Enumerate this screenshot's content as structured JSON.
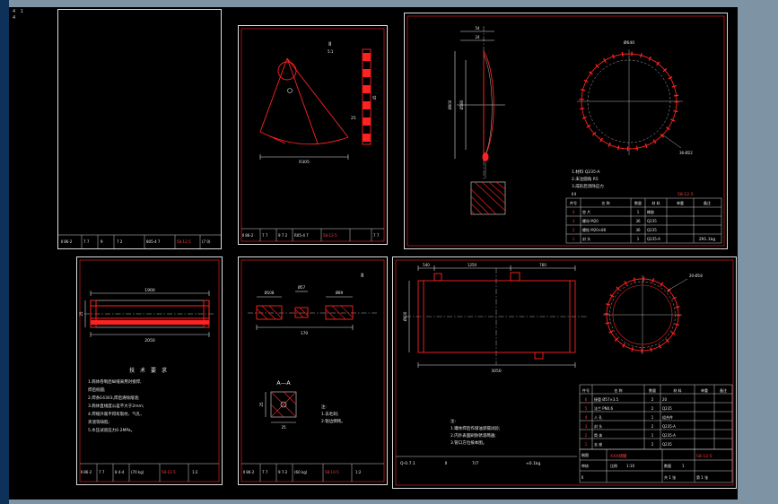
{
  "colors": {
    "frame": "#7e93a4",
    "sidebar": "#0d3158",
    "canvas": "#000000",
    "line_red": "#ff2222",
    "line_white": "#e8e8e8"
  },
  "corner_note": {
    "l1": "4 1",
    "l2": "4"
  },
  "p1": {
    "footer": [
      "Ⅱ 86-2",
      "7 7",
      "9",
      "7 2",
      "805-4 7",
      "58-12-5",
      "(7 0)"
    ]
  },
  "p2": {
    "mark": "Ⅱ",
    "scale": "5:1",
    "dim_r": "R305",
    "dim_a": "25",
    "dim_b": "45",
    "footer": [
      "Ⅱ 86-2",
      "7 7",
      "9 7 2",
      "R05-4 7",
      "58-12-5",
      "7 7"
    ]
  },
  "p3": {
    "dim_t1": "54",
    "dim_t2": "24",
    "dim_l1": "Ø600",
    "dim_l2": "Ø580",
    "dim_c": "Ø640",
    "leader": "36-Ø22",
    "notes": [
      "1.材料 Q235-A",
      "2.未注圆角 R5",
      "3.成形后消除应力"
    ],
    "tag": "Ⅱ Ⅱ",
    "code": "58-12-5",
    "hdr": [
      "件号",
      "名 称",
      "数量",
      "材 料",
      "单重",
      "备注"
    ],
    "rows": [
      [
        "4",
        "垫 片",
        "1",
        "橡胶"
      ],
      [
        "3",
        "螺母 M20",
        "36",
        "Q235"
      ],
      [
        "2",
        "螺栓 M20×80",
        "36",
        "Q235"
      ],
      [
        "1",
        "封 头",
        "1",
        "Q235-A"
      ]
    ],
    "mass": "291.1kg"
  },
  "p4": {
    "dim_top": "1900",
    "dim_bot": "2050",
    "dim_left": "25",
    "tech_title": "技 术 要 求",
    "notes": [
      "1.筒体卷制后纵缝采用对接焊,",
      "  焊后校圆;",
      "2.焊条E4303,焊后清除熔渣;",
      "3.筒体直线度公差不大于2mm;",
      "4.焊缝外观不得有裂纹、气孔、",
      "  夹渣等缺陷;",
      "5.水压试验压力0.2MPa。"
    ],
    "footer": [
      "Ⅱ 86-2",
      "7 7",
      "8 4-4",
      "(70 kg)",
      "58-12-5",
      "1:2"
    ]
  },
  "p5": {
    "mark": "Ⅱ",
    "dim_1": "Ø108",
    "dim_2": "Ø57",
    "dim_3": "Ø89",
    "dim_bot": "170",
    "section": "A—A",
    "sq_v": "25",
    "sq_h": "25",
    "notes": [
      "注:",
      "1.去毛刺;",
      "2.锐边倒钝。"
    ],
    "footer": [
      "Ⅱ 86-2",
      "7 7",
      "9 7-2",
      "(60 kg)",
      "58-10-5",
      "1:2"
    ]
  },
  "p6": {
    "dim_t1": "540",
    "dim_t2": "1250",
    "dim_t3": "760",
    "dim_bot": "3050",
    "dim_left": "Ø600",
    "leader": "20-Ø18",
    "notes": [
      "注:",
      "1.罐体焊后作煤油渗漏试验;",
      "2.内外表面刷防锈漆两遍;",
      "3.管口方位按本图。"
    ],
    "strip": [
      "Q-0.7.1",
      "Ⅱ",
      "7/7",
      "≈0.1kg"
    ],
    "hdr": [
      "件号",
      "名  称",
      "数量",
      "材 料",
      "单重",
      "备注"
    ],
    "rows": [
      [
        "6",
        "接管 Ø57×3.5",
        "2",
        "20"
      ],
      [
        "5",
        "法兰 PN0.6",
        "2",
        "Q235"
      ],
      [
        "4",
        "人 孔",
        "1",
        "组合件"
      ],
      [
        "3",
        "封 头",
        "2",
        "Q235-A"
      ],
      [
        "2",
        "筒 体",
        "1",
        "Q235-A"
      ],
      [
        "1",
        "支 座",
        "2",
        "Q235"
      ]
    ],
    "tb": {
      "zhitu": "制图",
      "shenhe": "审核",
      "name": "XXX储罐",
      "code": "58-12-5",
      "scale_lbl": "比例",
      "scale": "1:10",
      "qty_lbl": "数量",
      "qty": "1",
      "sheet1": "共 1 张",
      "sheet2": "第 1 张",
      "mark": "Ⅱ"
    }
  }
}
